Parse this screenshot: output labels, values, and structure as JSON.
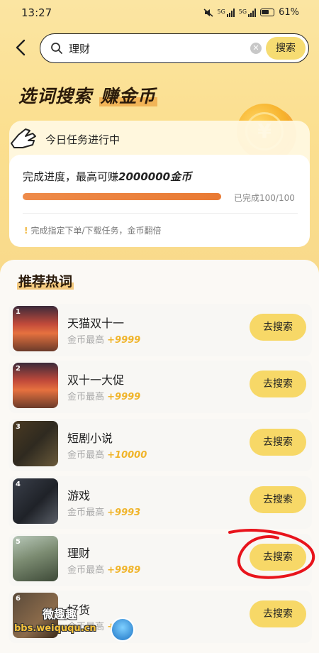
{
  "status": {
    "time": "13:27",
    "net1": "5G",
    "net2": "5G",
    "battery": "61%"
  },
  "search": {
    "value": "理财",
    "button": "搜索"
  },
  "banner": {
    "title_part1": "选词搜索",
    "title_part2": "赚金币",
    "coin_symbol": "¥"
  },
  "task": {
    "title": "今日任务进行中",
    "progress_prefix": "完成进度，最高可赚",
    "progress_amount": "2000000金币",
    "progress_fraction": 1.0,
    "done": "已完成100/100",
    "tip": "完成指定下单/下载任务，金币翻倍"
  },
  "recommend": {
    "title": "推荐热词",
    "items": [
      {
        "num": "1",
        "name": "天猫双十一",
        "sub": "金币最高",
        "reward": "+9999",
        "button": "去搜索",
        "thumb": "lantern"
      },
      {
        "num": "2",
        "name": "双十一大促",
        "sub": "金币最高",
        "reward": "+9999",
        "button": "去搜索",
        "thumb": "lantern"
      },
      {
        "num": "3",
        "name": "短剧小说",
        "sub": "金币最高",
        "reward": "+10000",
        "button": "去搜索",
        "thumb": "book"
      },
      {
        "num": "4",
        "name": "游戏",
        "sub": "金币最高",
        "reward": "+9993",
        "button": "去搜索",
        "thumb": "desk"
      },
      {
        "num": "5",
        "name": "理财",
        "sub": "金币最高",
        "reward": "+9989",
        "button": "去搜索",
        "thumb": "jar"
      },
      {
        "num": "6",
        "name": "好货",
        "sub": "金币最高",
        "reward": "+99",
        "button": "去搜索",
        "thumb": "shop"
      }
    ]
  },
  "watermark": {
    "line1": "微趣趣",
    "line2": "bbs.weiququ.cn"
  },
  "colors": {
    "accent": "#f7d867",
    "orange": "#e97a33",
    "reward": "#f0b42a",
    "annotation": "#e8141c"
  }
}
